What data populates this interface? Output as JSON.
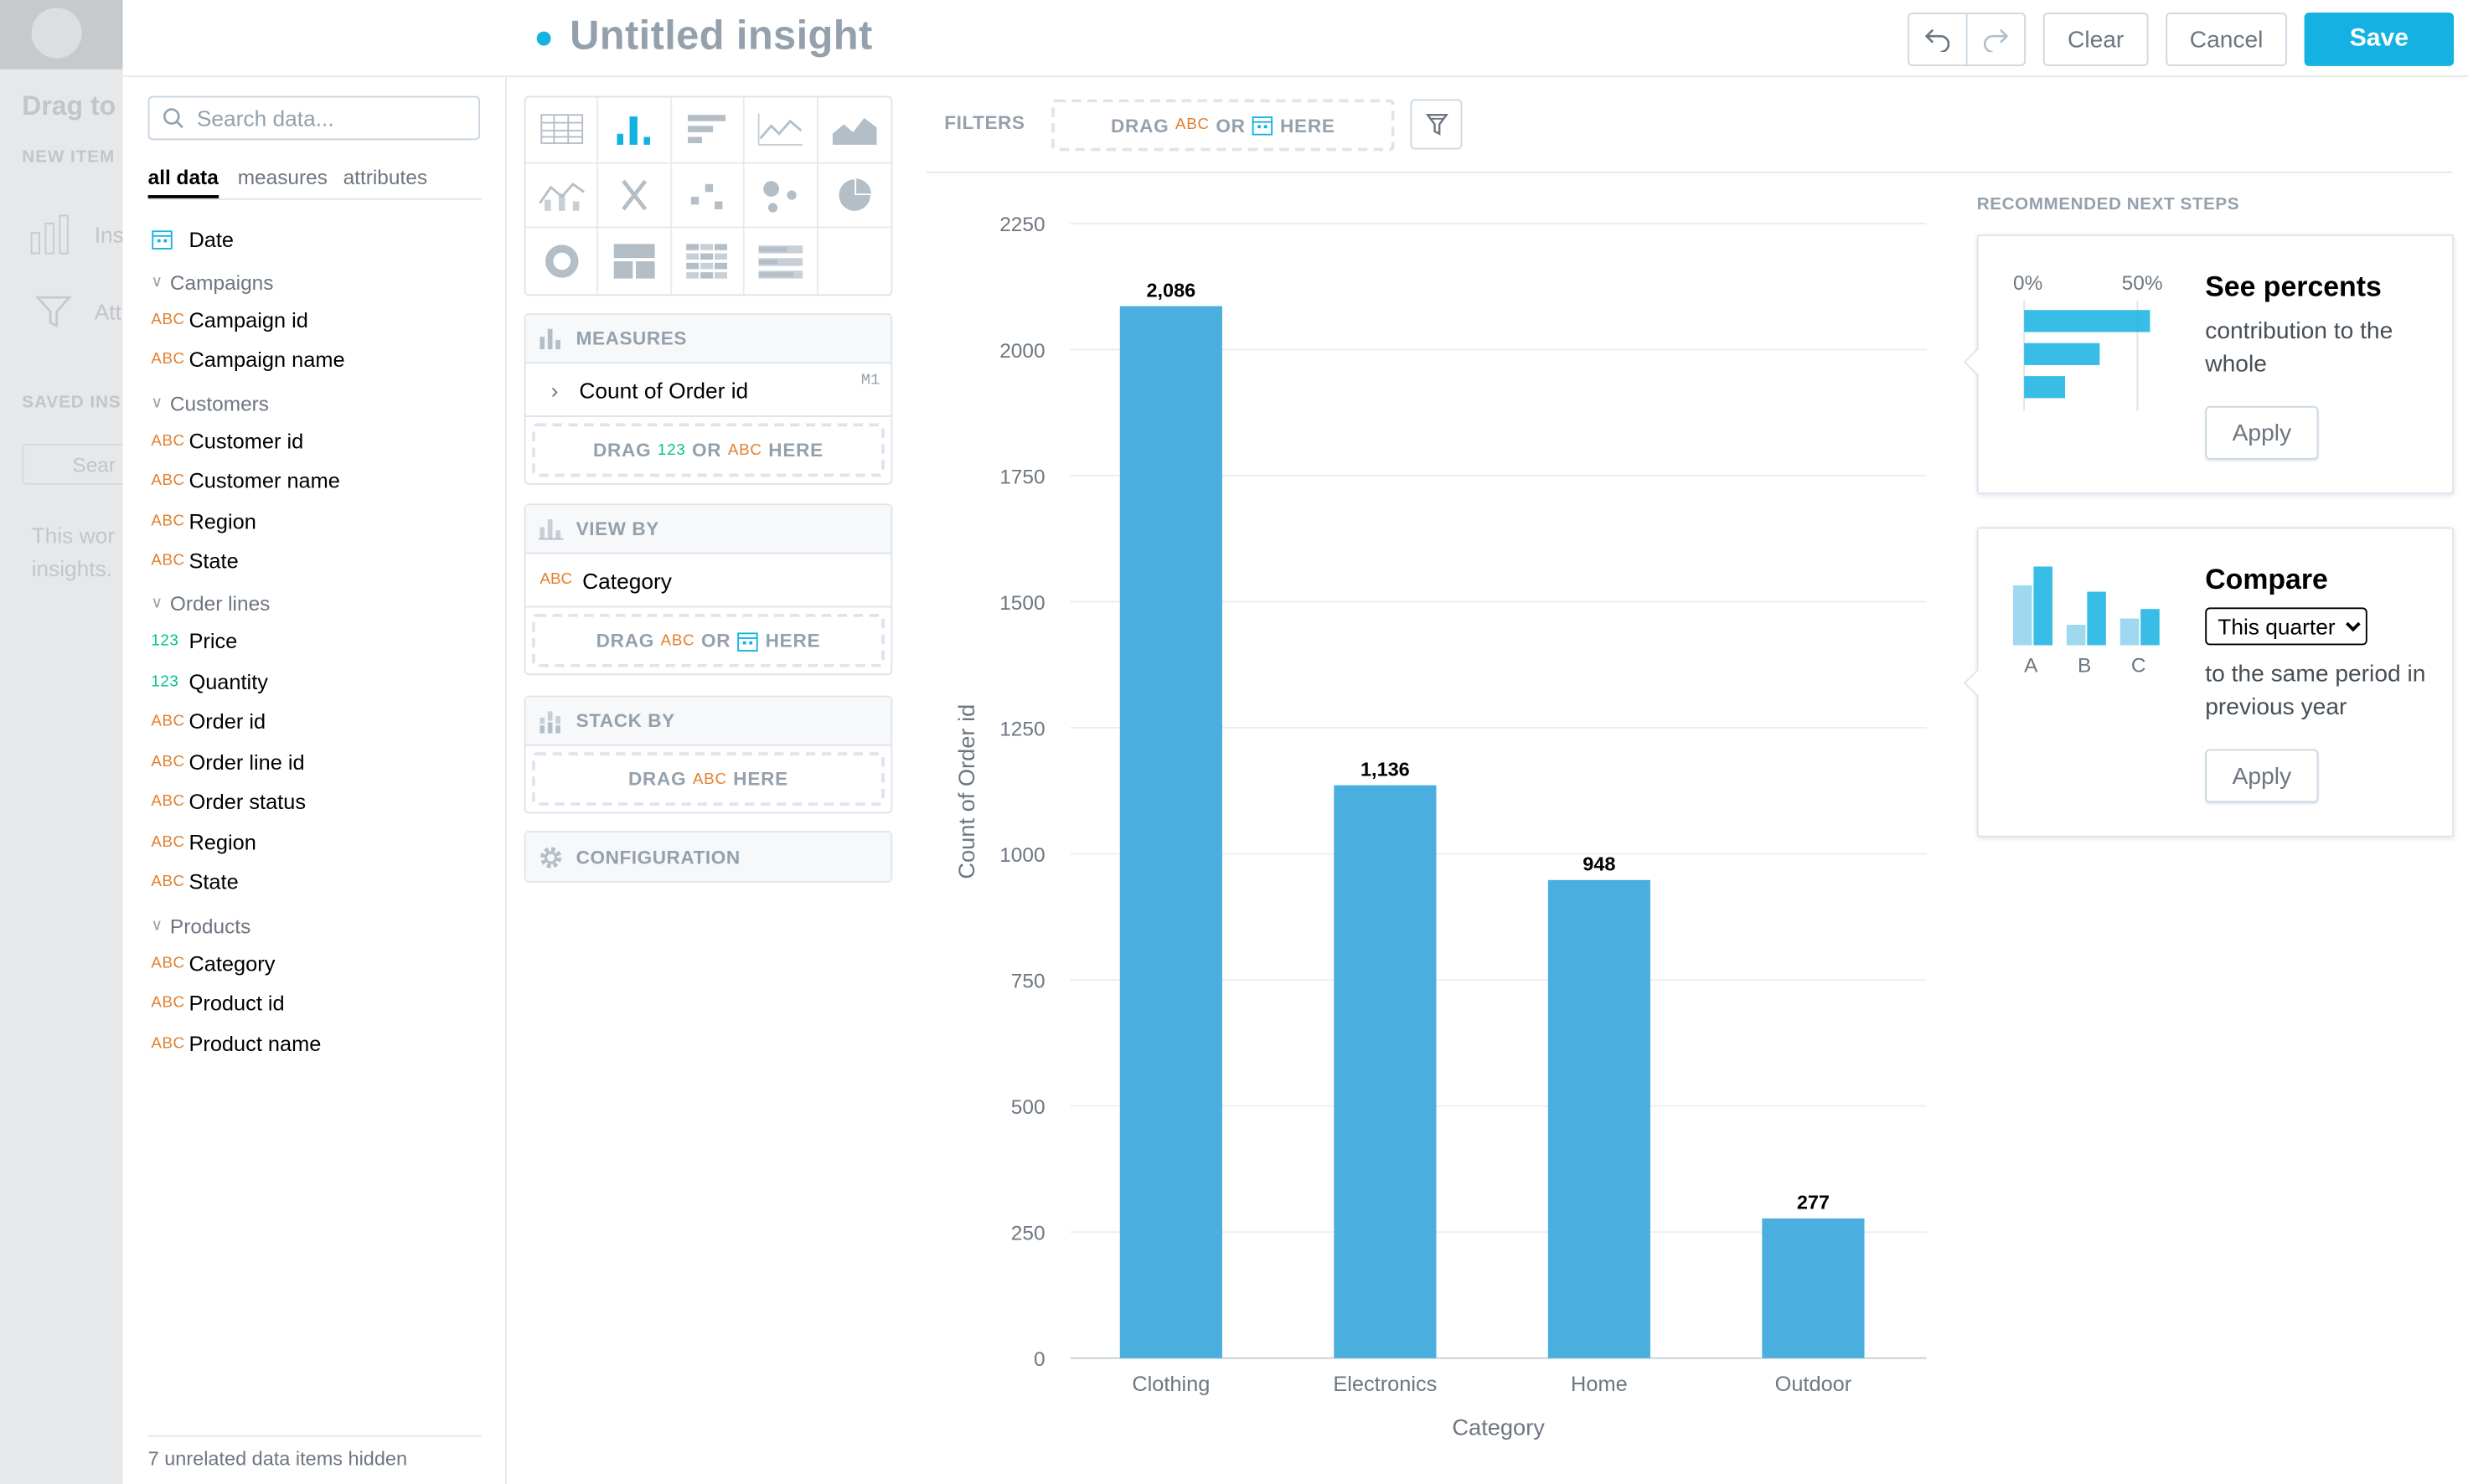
{
  "window": {
    "title": "Untitled insight"
  },
  "toolbar": {
    "clear_label": "Clear",
    "cancel_label": "Cancel",
    "save_label": "Save"
  },
  "backdrop": {
    "drag_text": "Drag to",
    "new_item_label": "NEW ITEM",
    "insight_label": "Ins",
    "attribute_label": "Att",
    "saved_label": "SAVED INS",
    "search_placeholder": "Sear",
    "hint_line1": "This wor",
    "hint_line2": "insights."
  },
  "catalog": {
    "search_placeholder": "Search data...",
    "tabs": [
      "all data",
      "measures",
      "attributes"
    ],
    "date_label": "Date",
    "groups": [
      {
        "name": "Campaigns",
        "items": [
          {
            "type": "ABC",
            "label": "Campaign id"
          },
          {
            "type": "ABC",
            "label": "Campaign name"
          }
        ]
      },
      {
        "name": "Customers",
        "items": [
          {
            "type": "ABC",
            "label": "Customer id"
          },
          {
            "type": "ABC",
            "label": "Customer name"
          },
          {
            "type": "ABC",
            "label": "Region"
          },
          {
            "type": "ABC",
            "label": "State"
          }
        ]
      },
      {
        "name": "Order lines",
        "items": [
          {
            "type": "123",
            "label": "Price"
          },
          {
            "type": "123",
            "label": "Quantity"
          },
          {
            "type": "ABC",
            "label": "Order id"
          },
          {
            "type": "ABC",
            "label": "Order line id"
          },
          {
            "type": "ABC",
            "label": "Order status"
          },
          {
            "type": "ABC",
            "label": "Region"
          },
          {
            "type": "ABC",
            "label": "State"
          }
        ]
      },
      {
        "name": "Products",
        "items": [
          {
            "type": "ABC",
            "label": "Category"
          },
          {
            "type": "ABC",
            "label": "Product id"
          },
          {
            "type": "ABC",
            "label": "Product name"
          }
        ]
      }
    ],
    "footer": "7 unrelated data items hidden"
  },
  "buckets": {
    "measures": {
      "title": "MEASURES",
      "item": "Count of Order id",
      "item_id": "M1",
      "drop_drag": "DRAG",
      "drop_num": "123",
      "drop_or": "OR",
      "drop_abc": "ABC",
      "drop_here": "HERE"
    },
    "view_by": {
      "title": "VIEW BY",
      "item_type": "ABC",
      "item": "Category",
      "drop_drag": "DRAG",
      "drop_abc": "ABC",
      "drop_or": "OR",
      "drop_here": "HERE"
    },
    "stack_by": {
      "title": "STACK BY",
      "drop_drag": "DRAG",
      "drop_abc": "ABC",
      "drop_here": "HERE"
    },
    "configuration": {
      "title": "CONFIGURATION"
    }
  },
  "filters": {
    "label": "FILTERS",
    "drop_drag": "DRAG",
    "drop_abc": "ABC",
    "drop_or": "OR",
    "drop_here": "HERE"
  },
  "chart_data": {
    "type": "bar",
    "categories": [
      "Clothing",
      "Electronics",
      "Home",
      "Outdoor"
    ],
    "values": [
      2086,
      1136,
      948,
      277
    ],
    "data_labels": [
      "2,086",
      "1,136",
      "948",
      "277"
    ],
    "xlabel": "Category",
    "ylabel": "Count of Order id",
    "ylim": [
      0,
      2250
    ],
    "yticks": [
      0,
      250,
      500,
      750,
      1000,
      1250,
      1500,
      1750,
      2000,
      2250
    ],
    "grid": true,
    "bar_color": "#4aaedf"
  },
  "recommendations": {
    "heading": "RECOMMENDED NEXT STEPS",
    "percents": {
      "title": "See percents",
      "text": "contribution to the whole",
      "tick_low": "0%",
      "tick_high": "50%",
      "apply_label": "Apply"
    },
    "compare": {
      "title": "Compare",
      "select_value": "This quarter",
      "text": "to the same period in previous year",
      "labels": [
        "A",
        "B",
        "C"
      ],
      "apply_label": "Apply"
    }
  },
  "colors": {
    "accent": "#14b2e2",
    "bar": "#4aaedf",
    "attribute": "#e1812f",
    "fact": "#00c18d"
  }
}
